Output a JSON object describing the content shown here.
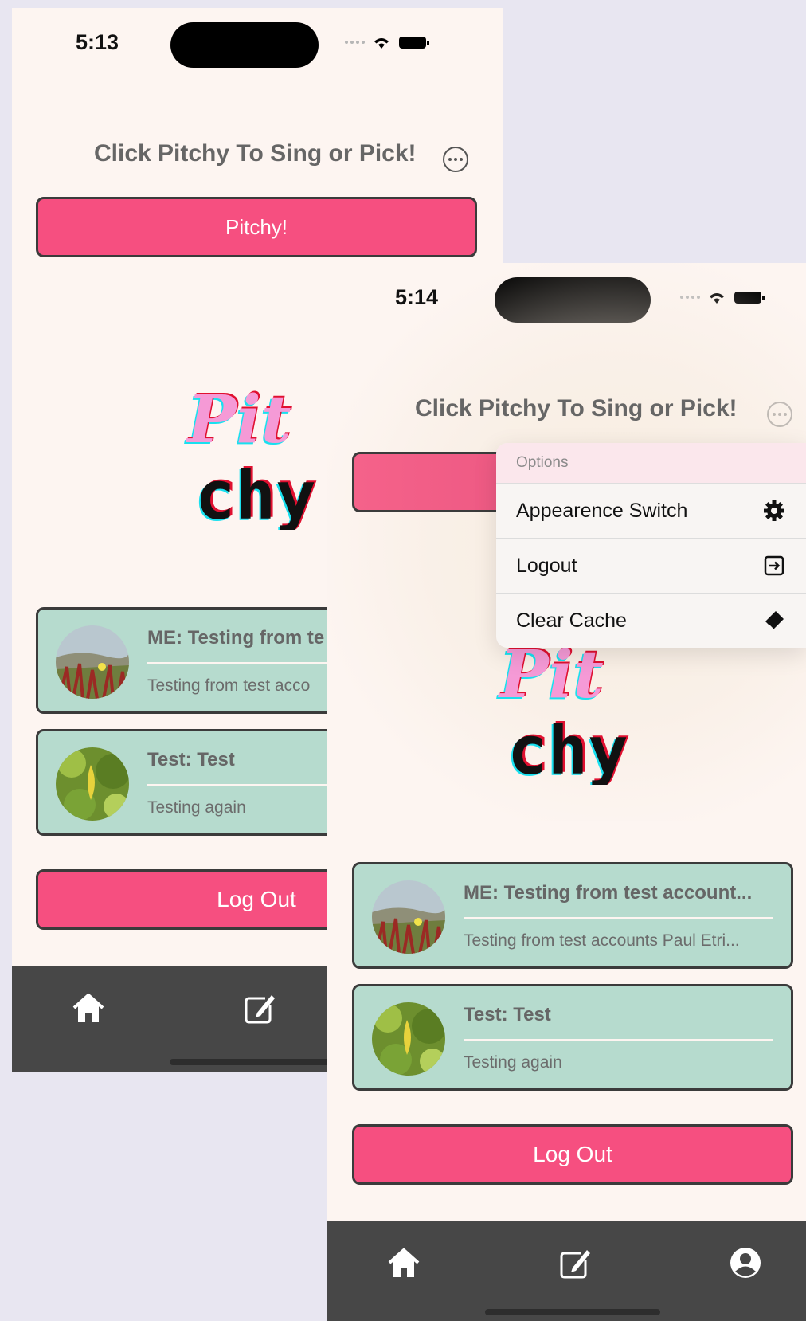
{
  "colors": {
    "accent": "#f64f80",
    "card": "#b6dbce",
    "background": "#fdf5f1",
    "tabbar": "#474747",
    "page": "#e8e6f1"
  },
  "screen_a": {
    "status": {
      "time": "5:13"
    },
    "header": {
      "title": "Click Pitchy To Sing or Pick!",
      "more_icon": "ellipsis-circle-icon"
    },
    "pitchy_button": "Pitchy!",
    "logo": {
      "line1": "Pit",
      "line2": "chy"
    },
    "cards": [
      {
        "title": "ME: Testing from te",
        "subtitle": "Testing from test acco"
      },
      {
        "title": "Test: Test",
        "subtitle": "Testing again"
      }
    ],
    "logout_button": "Log Out",
    "tabs": [
      "home-icon",
      "compose-icon"
    ]
  },
  "screen_b": {
    "status": {
      "time": "5:14"
    },
    "header": {
      "title": "Click Pitchy To Sing or Pick!",
      "more_icon": "ellipsis-circle-icon"
    },
    "logo": {
      "line1": "Pit",
      "line2": "chy"
    },
    "menu": {
      "header": "Options",
      "items": [
        {
          "label": "Appearence Switch",
          "icon": "gear-icon"
        },
        {
          "label": "Logout",
          "icon": "logout-arrow-icon"
        },
        {
          "label": "Clear Cache",
          "icon": "eraser-icon"
        }
      ]
    },
    "cards": [
      {
        "title": "ME: Testing from test account...",
        "subtitle": "Testing from test accounts Paul Etri..."
      },
      {
        "title": "Test: Test",
        "subtitle": "Testing again"
      }
    ],
    "logout_button": "Log Out",
    "tabs": [
      "home-icon",
      "compose-icon",
      "profile-icon"
    ]
  }
}
